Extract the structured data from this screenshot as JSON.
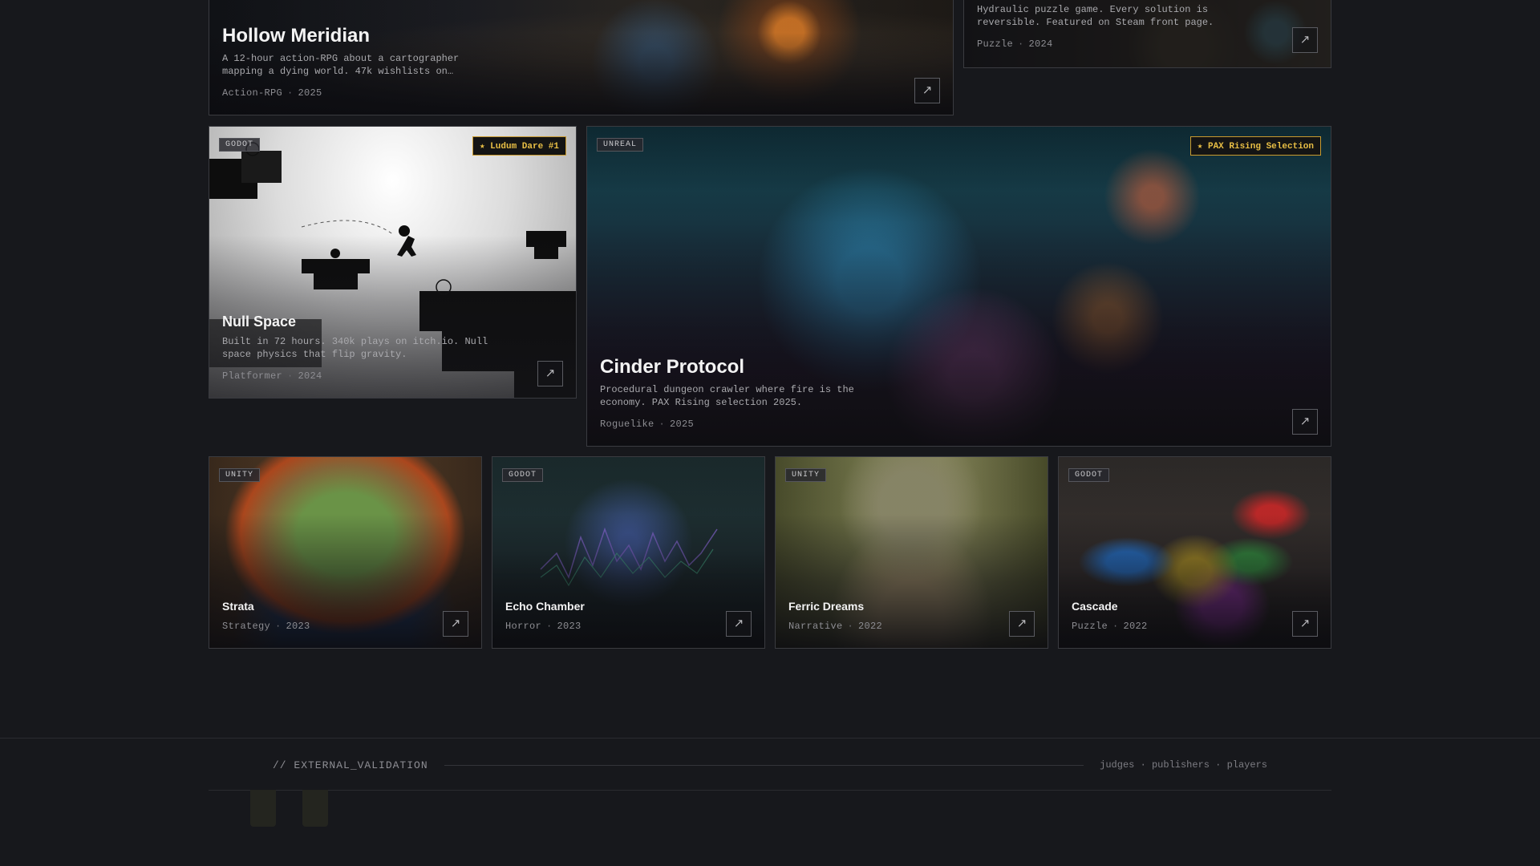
{
  "projects": {
    "hollow": {
      "title": "Hollow Meridian",
      "desc": "A 12-hour action-RPG about a cartographer mapping a dying world. 47k wishlists on…",
      "genre": "Action-RPG",
      "year": "2025",
      "arrow": "↗"
    },
    "puzzle_top": {
      "desc": "Hydraulic puzzle game. Every solution is reversible. Featured on Steam front page.",
      "genre": "Puzzle",
      "year": "2024",
      "arrow": "↗"
    },
    "null_space": {
      "title": "Null Space",
      "engine": "GODOT",
      "award": "★ Ludum Dare #1",
      "desc": "Built in 72 hours. 340k plays on itch.io. Null space physics that flip gravity.",
      "genre": "Platformer",
      "year": "2024",
      "arrow": "↗"
    },
    "cinder": {
      "title": "Cinder Protocol",
      "engine": "UNREAL",
      "award": "★ PAX Rising Selection",
      "desc": "Procedural dungeon crawler where fire is the economy. PAX Rising selection 2025.",
      "genre": "Roguelike",
      "year": "2025",
      "arrow": "↗"
    },
    "strata": {
      "title": "Strata",
      "engine": "UNITY",
      "genre": "Strategy",
      "year": "2023",
      "arrow": "↗"
    },
    "echo": {
      "title": "Echo Chamber",
      "engine": "GODOT",
      "genre": "Horror",
      "year": "2023",
      "arrow": "↗"
    },
    "ferric": {
      "title": "Ferric Dreams",
      "engine": "UNITY",
      "genre": "Narrative",
      "year": "2022",
      "arrow": "↗"
    },
    "cascade": {
      "title": "Cascade",
      "engine": "GODOT",
      "genre": "Puzzle",
      "year": "2022",
      "arrow": "↗"
    }
  },
  "validation": {
    "label": "// EXTERNAL_VALIDATION",
    "audience": "judges · publishers · players"
  },
  "colors": {
    "background": "#17181c",
    "award_gold": "#e9bf45",
    "card_border": "#3a3b40"
  }
}
